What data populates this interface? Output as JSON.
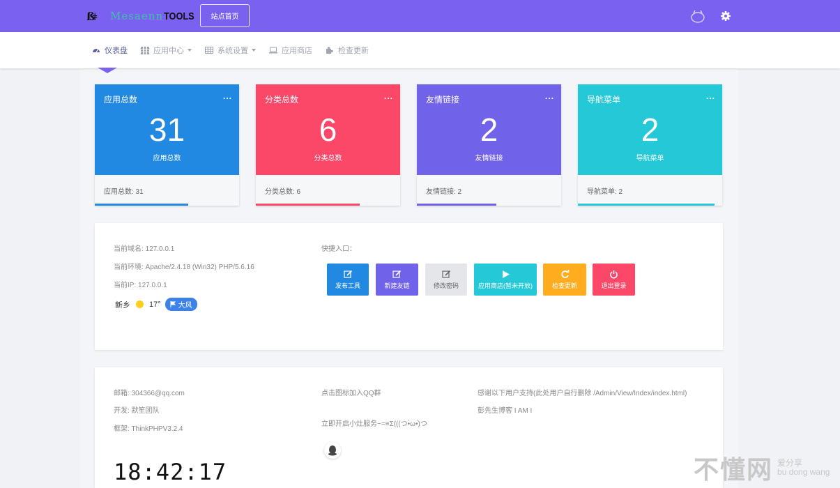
{
  "header": {
    "logo_word1": "Mesaenn",
    "logo_word2": "TOOLS",
    "site_home_label": "站点首页",
    "icons": [
      "bell-icon",
      "gear-icon"
    ]
  },
  "nav": {
    "items": [
      {
        "label": "仪表盘",
        "icon": "dashboard-icon",
        "dropdown": false
      },
      {
        "label": "应用中心",
        "icon": "grid-icon",
        "dropdown": true
      },
      {
        "label": "系统设置",
        "icon": "table-icon",
        "dropdown": true
      },
      {
        "label": "应用商店",
        "icon": "laptop-icon",
        "dropdown": false
      },
      {
        "label": "检查更新",
        "icon": "puzzle-icon",
        "dropdown": false
      }
    ]
  },
  "stats": [
    {
      "label": "应用总数",
      "more": "...",
      "value": "31",
      "sub": "应用总数",
      "footer": "应用总数: 31",
      "color": "#2289e3",
      "bar_color": "#2289e3",
      "progress": 0.65
    },
    {
      "label": "分类总数",
      "more": "...",
      "value": "6",
      "sub": "分类总数",
      "footer": "分类总数: 6",
      "color": "#fb4868",
      "bar_color": "#fb4868",
      "progress": 0.72
    },
    {
      "label": "友情链接",
      "more": "...",
      "value": "2",
      "sub": "友情链接",
      "footer": "友情链接: 2",
      "color": "#7162ea",
      "bar_color": "#7162ea",
      "progress": 0.55
    },
    {
      "label": "导航菜单",
      "more": "...",
      "value": "2",
      "sub": "导航菜单",
      "footer": "导航菜单: 2",
      "color": "#25c8d6",
      "bar_color": "#25c8d6",
      "progress": 0.95
    }
  ],
  "info": {
    "domain": "当前域名: 127.0.0.1",
    "env": "当前环境: Apache/2.4.18 (Win32) PHP/5.6.16",
    "ip": "当前IP: 127.0.0.1",
    "weather_city": "新乡",
    "weather_temp": "17°",
    "weather_wind": "大风"
  },
  "quick": {
    "label": "快捷入口：",
    "buttons": [
      {
        "label": "发布工具",
        "icon": "edit-icon",
        "color": "#2289e3"
      },
      {
        "label": "新建友链",
        "icon": "edit-icon",
        "color": "#7162ea"
      },
      {
        "label": "修改密码",
        "icon": "edit-icon",
        "color": "#e4e6ea"
      },
      {
        "label": "应用商店(暂未开放)",
        "icon": "play-icon",
        "color": "#25c8d6"
      },
      {
        "label": "检查更新",
        "icon": "refresh-icon",
        "color": "#ffad1f"
      },
      {
        "label": "退出登录",
        "icon": "power-icon",
        "color": "#fb4868"
      }
    ]
  },
  "footer": {
    "email": "邮箱: 304366@qq.com",
    "dev": "开发: 默笙团队",
    "framework": "框架: ThinkPHPV3.2.4",
    "qq_group": "点击图标加入QQ群",
    "service": "立即开启小灶服务~=≡Σ(((つ•̀ω•́)つ",
    "thanks": "感谢以下用户支持(此处用户自行删除 /Admin/View/Index/index.html)",
    "blog": "彭先生博客  I AM I",
    "clock": "18:42:17"
  },
  "watermark": {
    "big": "不懂网",
    "small1": "爱分享",
    "small2": "bu dong wang"
  }
}
